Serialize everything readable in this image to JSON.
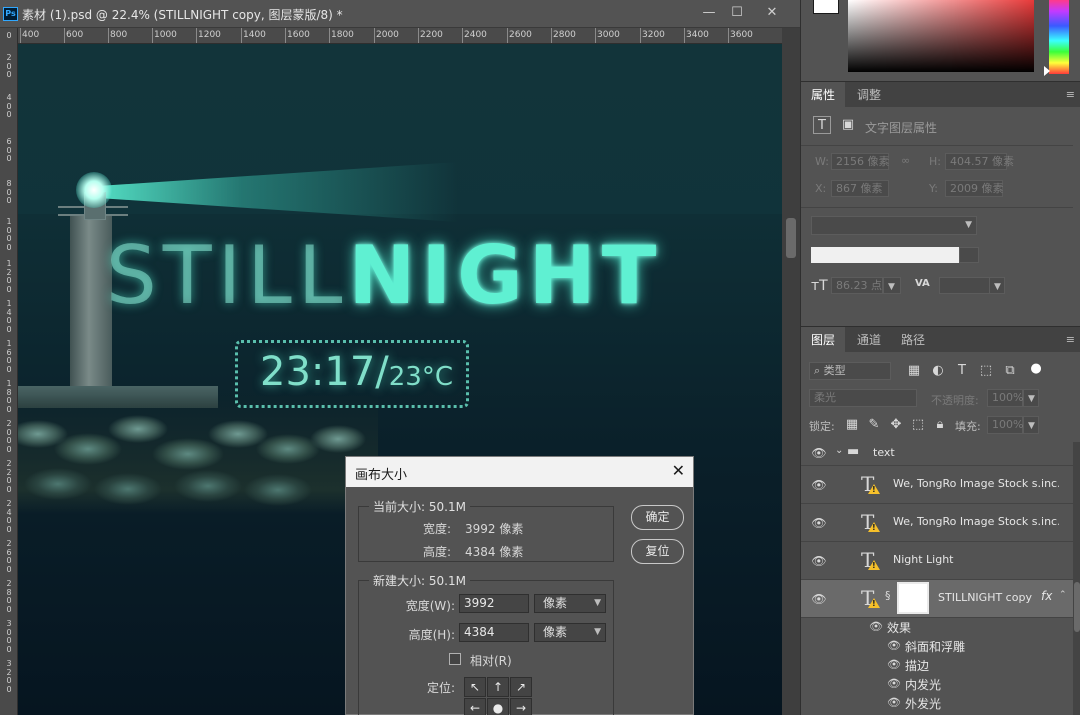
{
  "document": {
    "ps_badge": "Ps",
    "title": "素材 (1).psd @ 22.4% (STILLNIGHT copy, 图层蒙版/8) *",
    "minimize": "▭",
    "restore": "☐",
    "close": "✕",
    "ruler_h": [
      "400",
      "600",
      "800",
      "1000",
      "1200",
      "1400",
      "1600",
      "1800",
      "2000",
      "2200",
      "2400",
      "2600",
      "2800",
      "3000",
      "3200",
      "3400",
      "3600"
    ],
    "ruler_v": [
      "0",
      "200",
      "400",
      "600",
      "800",
      "1000",
      "1200",
      "1400",
      "1600",
      "1800",
      "2000",
      "2200",
      "2400",
      "2600",
      "2800",
      "3000",
      "3200"
    ]
  },
  "artwork": {
    "still": "STILL",
    "night": "NIGHT",
    "clock_time": "23:17/",
    "clock_temp": "23°C"
  },
  "dialog": {
    "title": "画布大小",
    "close": "✕",
    "current_size_label": "当前大小: 50.1M",
    "width_label": "宽度:",
    "width_value": "3992 像素",
    "height_label": "高度:",
    "height_value": "4384 像素",
    "new_size_label": "新建大小: 50.1M",
    "new_width_label": "宽度(W):",
    "new_width_value": "3992",
    "new_height_label": "高度(H):",
    "new_height_value": "4384",
    "unit": "像素",
    "relative_label": "相对(R)",
    "anchor_label": "定位:",
    "ok": "确定",
    "reset": "复位",
    "anchor_arrows": [
      "↖",
      "↑",
      "↗",
      "←",
      "●",
      "→"
    ]
  },
  "properties": {
    "tabs": [
      "属性",
      "调整"
    ],
    "section_title": "文字图层属性",
    "w_label": "W:",
    "w_value": "2156 像素",
    "h_label": "H:",
    "h_value": "404.57 像素",
    "x_label": "X:",
    "x_value": "867 像素",
    "y_label": "Y:",
    "y_value": "2009 像素",
    "font_size": "86.23 点",
    "menu": "≡"
  },
  "layers_panel": {
    "tabs": [
      "图层",
      "通道",
      "路径"
    ],
    "filter_kind": "类型",
    "blend_mode": "柔光",
    "opacity_label": "不透明度:",
    "opacity_value": "100%",
    "lock_label": "锁定:",
    "fill_label": "填充:",
    "fill_value": "100%",
    "group_name": "text",
    "layers": [
      {
        "name": "We, TongRo Image Stock s.inc..."
      },
      {
        "name": "We, TongRo Image Stock s.inc..."
      },
      {
        "name": "Night Light"
      },
      {
        "name": "STILLNIGHT copy"
      }
    ],
    "effects_label": "效果",
    "effects": [
      "斜面和浮雕",
      "描边",
      "内发光",
      "外发光"
    ],
    "fx": "fx",
    "menu": "≡"
  },
  "colors": {
    "accent": "#31a8ff",
    "glow": "#5ff0d2",
    "warning": "#f6c02a"
  }
}
